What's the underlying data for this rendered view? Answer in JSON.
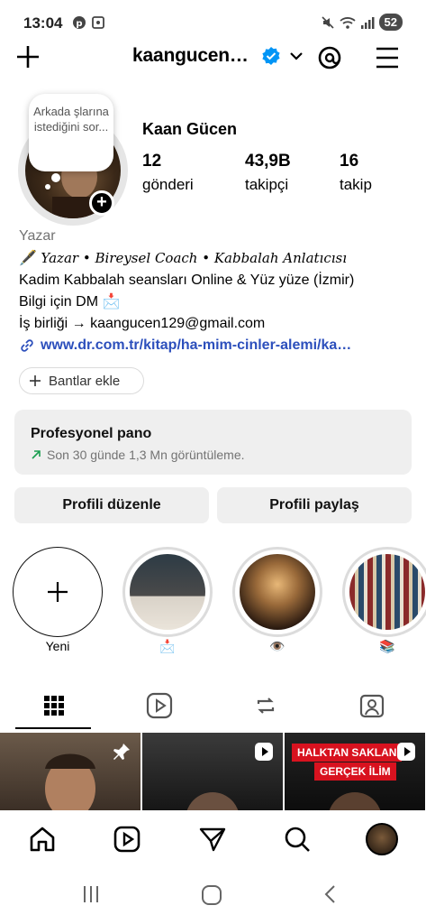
{
  "status_bar": {
    "time": "13:04",
    "battery": "52"
  },
  "header": {
    "username": "kaangucen…"
  },
  "profile": {
    "note": "Arkada şlarına istediğini sor...",
    "display_name": "Kaan Gücen",
    "stats": [
      {
        "value": "12",
        "label": "gönderi"
      },
      {
        "value": "43,9B",
        "label": "takipçi"
      },
      {
        "value": "16",
        "label": "takip"
      }
    ]
  },
  "bio": {
    "category": "Yazar",
    "line1_emoji": "🖋️",
    "line1": "Yazar • Bireysel Coach • Kabbalah Anlatıcısı",
    "line2": "Kadim Kabbalah seansları Online & Yüz yüze (İzmir)",
    "line3": "Bilgi için DM 📩",
    "line4": "İş birliği → kaangucen129@gmail.com",
    "link": "www.dr.com.tr/kitap/ha-mim-cinler-alemi/ka…"
  },
  "bantlar": {
    "label": "Bantlar ekle"
  },
  "dashboard": {
    "title": "Profesyonel pano",
    "subtitle": "Son 30 günde 1,3 Mn görüntüleme."
  },
  "actions": {
    "edit": "Profili düzenle",
    "share": "Profili paylaş"
  },
  "highlights": [
    {
      "caption": "Yeni"
    },
    {
      "caption": "📩"
    },
    {
      "caption": "👁️"
    },
    {
      "caption": "📚"
    }
  ],
  "grid": {
    "banner_line1": "HALKTAN SAKLAN",
    "banner_line2": "GERÇEK İLİM"
  },
  "colors": {
    "link": "#2c4fbc",
    "verified": "#0095f6",
    "banner_red": "#d8121f",
    "button_bg": "#efefef"
  }
}
